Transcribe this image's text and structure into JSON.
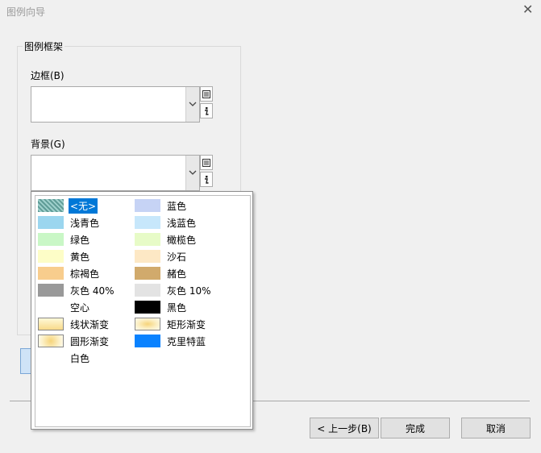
{
  "window": {
    "title": "图例向导",
    "close_glyph": "✕"
  },
  "group": {
    "title": "图例框架"
  },
  "border_field": {
    "label": "边框(B)",
    "value": ""
  },
  "background_field": {
    "label": "背景(G)",
    "value": ""
  },
  "colors": [
    {
      "label": "<无>",
      "swatch": "hatch",
      "selected": true
    },
    {
      "label": "蓝色",
      "swatch": "#c6d3f5"
    },
    {
      "label": "浅青色",
      "swatch": "#9bd6ef"
    },
    {
      "label": "浅蓝色",
      "swatch": "#c7e7fb"
    },
    {
      "label": "绿色",
      "swatch": "#c9f7c6"
    },
    {
      "label": "橄榄色",
      "swatch": "#e7fbc7"
    },
    {
      "label": "黄色",
      "swatch": "#fdfdc7"
    },
    {
      "label": "沙石",
      "swatch": "#fde8c5"
    },
    {
      "label": "棕褐色",
      "swatch": "#f8cd8d"
    },
    {
      "label": "赭色",
      "swatch": "#d1aa6c"
    },
    {
      "label": "灰色 40%",
      "swatch": "#999999"
    },
    {
      "label": "灰色 10%",
      "swatch": "#e3e3e3"
    },
    {
      "label": "空心",
      "swatch": "none"
    },
    {
      "label": "黑色",
      "swatch": "#000000"
    },
    {
      "label": "线状渐变",
      "swatch": "linear-gradient"
    },
    {
      "label": "矩形渐变",
      "swatch": "rect-gradient"
    },
    {
      "label": "圆形渐变",
      "swatch": "radial-gradient"
    },
    {
      "label": "克里特蓝",
      "swatch": "#0a82ff"
    },
    {
      "label": "白色",
      "swatch": "none"
    }
  ],
  "buttons": {
    "back": "< 上一步(B)",
    "finish": "完成",
    "cancel": "取消"
  }
}
